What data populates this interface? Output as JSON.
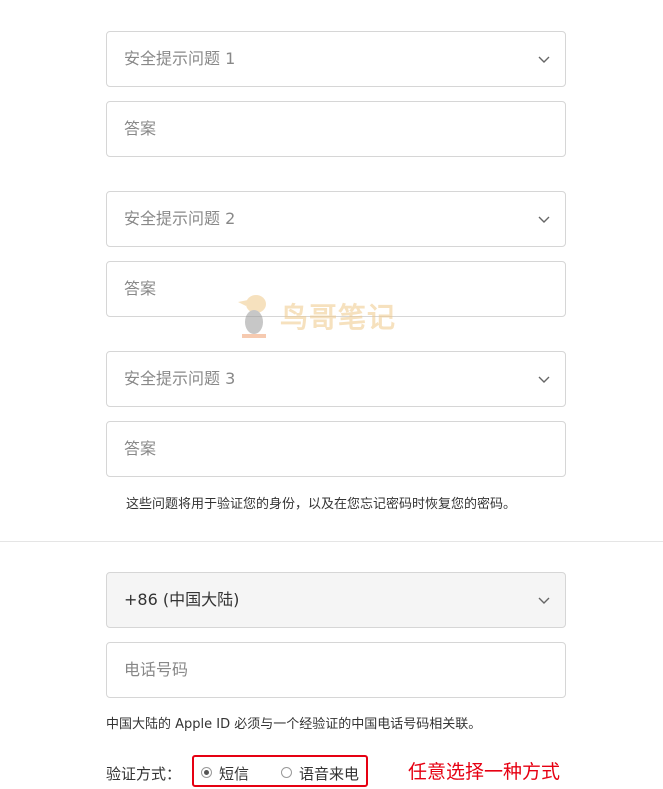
{
  "security": {
    "q1": {
      "placeholder": "安全提示问题 1",
      "answer_placeholder": "答案"
    },
    "q2": {
      "placeholder": "安全提示问题 2",
      "answer_placeholder": "答案"
    },
    "q3": {
      "placeholder": "安全提示问题 3",
      "answer_placeholder": "答案"
    },
    "note": "这些问题将用于验证您的身份，以及在您忘记密码时恢复您的密码。"
  },
  "phone": {
    "country_code": "+86 (中国大陆)",
    "number_placeholder": "电话号码",
    "note": "中国大陆的 Apple ID 必须与一个经验证的中国电话号码相关联。"
  },
  "verify": {
    "label": "验证方式：",
    "options": [
      {
        "label": "短信",
        "selected": true
      },
      {
        "label": "语音来电",
        "selected": false
      }
    ]
  },
  "annotation": "任意选择一种方式",
  "watermark": {
    "text": "鸟哥笔记"
  },
  "colors": {
    "annotation_red": "#e60012",
    "border": "#d6d6d6"
  }
}
